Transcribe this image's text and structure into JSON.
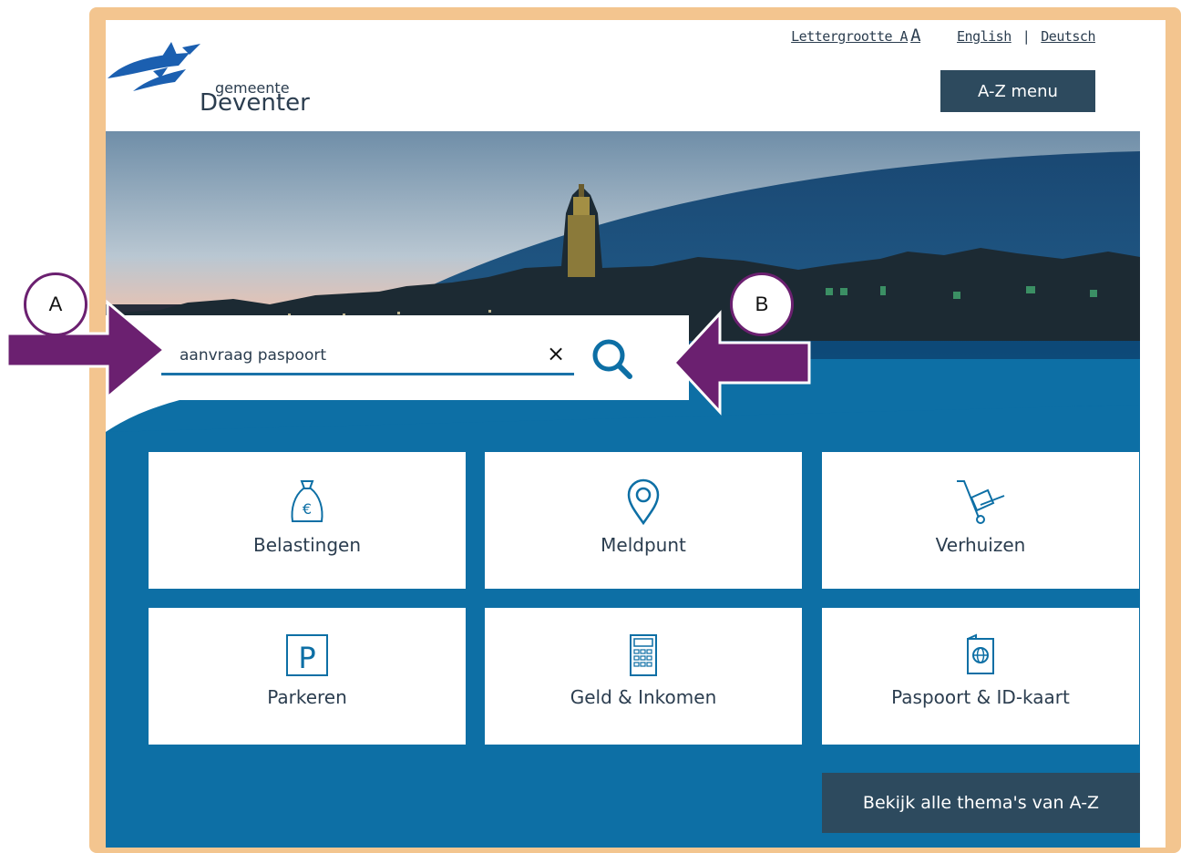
{
  "header": {
    "logo_small": "gemeente",
    "logo_big": "Deventer",
    "fontsize_label": "Lettergrootte A",
    "fontsize_big": "A",
    "lang_english": "English",
    "lang_separator": "|",
    "lang_deutsch": "Deutsch",
    "az_menu": "A-Z menu"
  },
  "search": {
    "value": "aanvraag paspoort",
    "clear_symbol": "×"
  },
  "tiles": [
    {
      "label": "Belastingen",
      "icon": "money-bag-icon"
    },
    {
      "label": "Meldpunt",
      "icon": "location-pin-icon"
    },
    {
      "label": "Verhuizen",
      "icon": "hand-truck-icon"
    },
    {
      "label": "Parkeren",
      "icon": "parking-icon"
    },
    {
      "label": "Geld & Inkomen",
      "icon": "calculator-icon"
    },
    {
      "label": "Paspoort & ID-kaart",
      "icon": "passport-icon"
    }
  ],
  "all_themes_button": "Bekijk alle thema's van A-Z",
  "callouts": {
    "a": "A",
    "b": "B"
  },
  "colors": {
    "frame": "#f3c58f",
    "brand_blue": "#0d6fa5",
    "dark_button": "#2d4a5e",
    "callout_purple": "#6b2070"
  }
}
